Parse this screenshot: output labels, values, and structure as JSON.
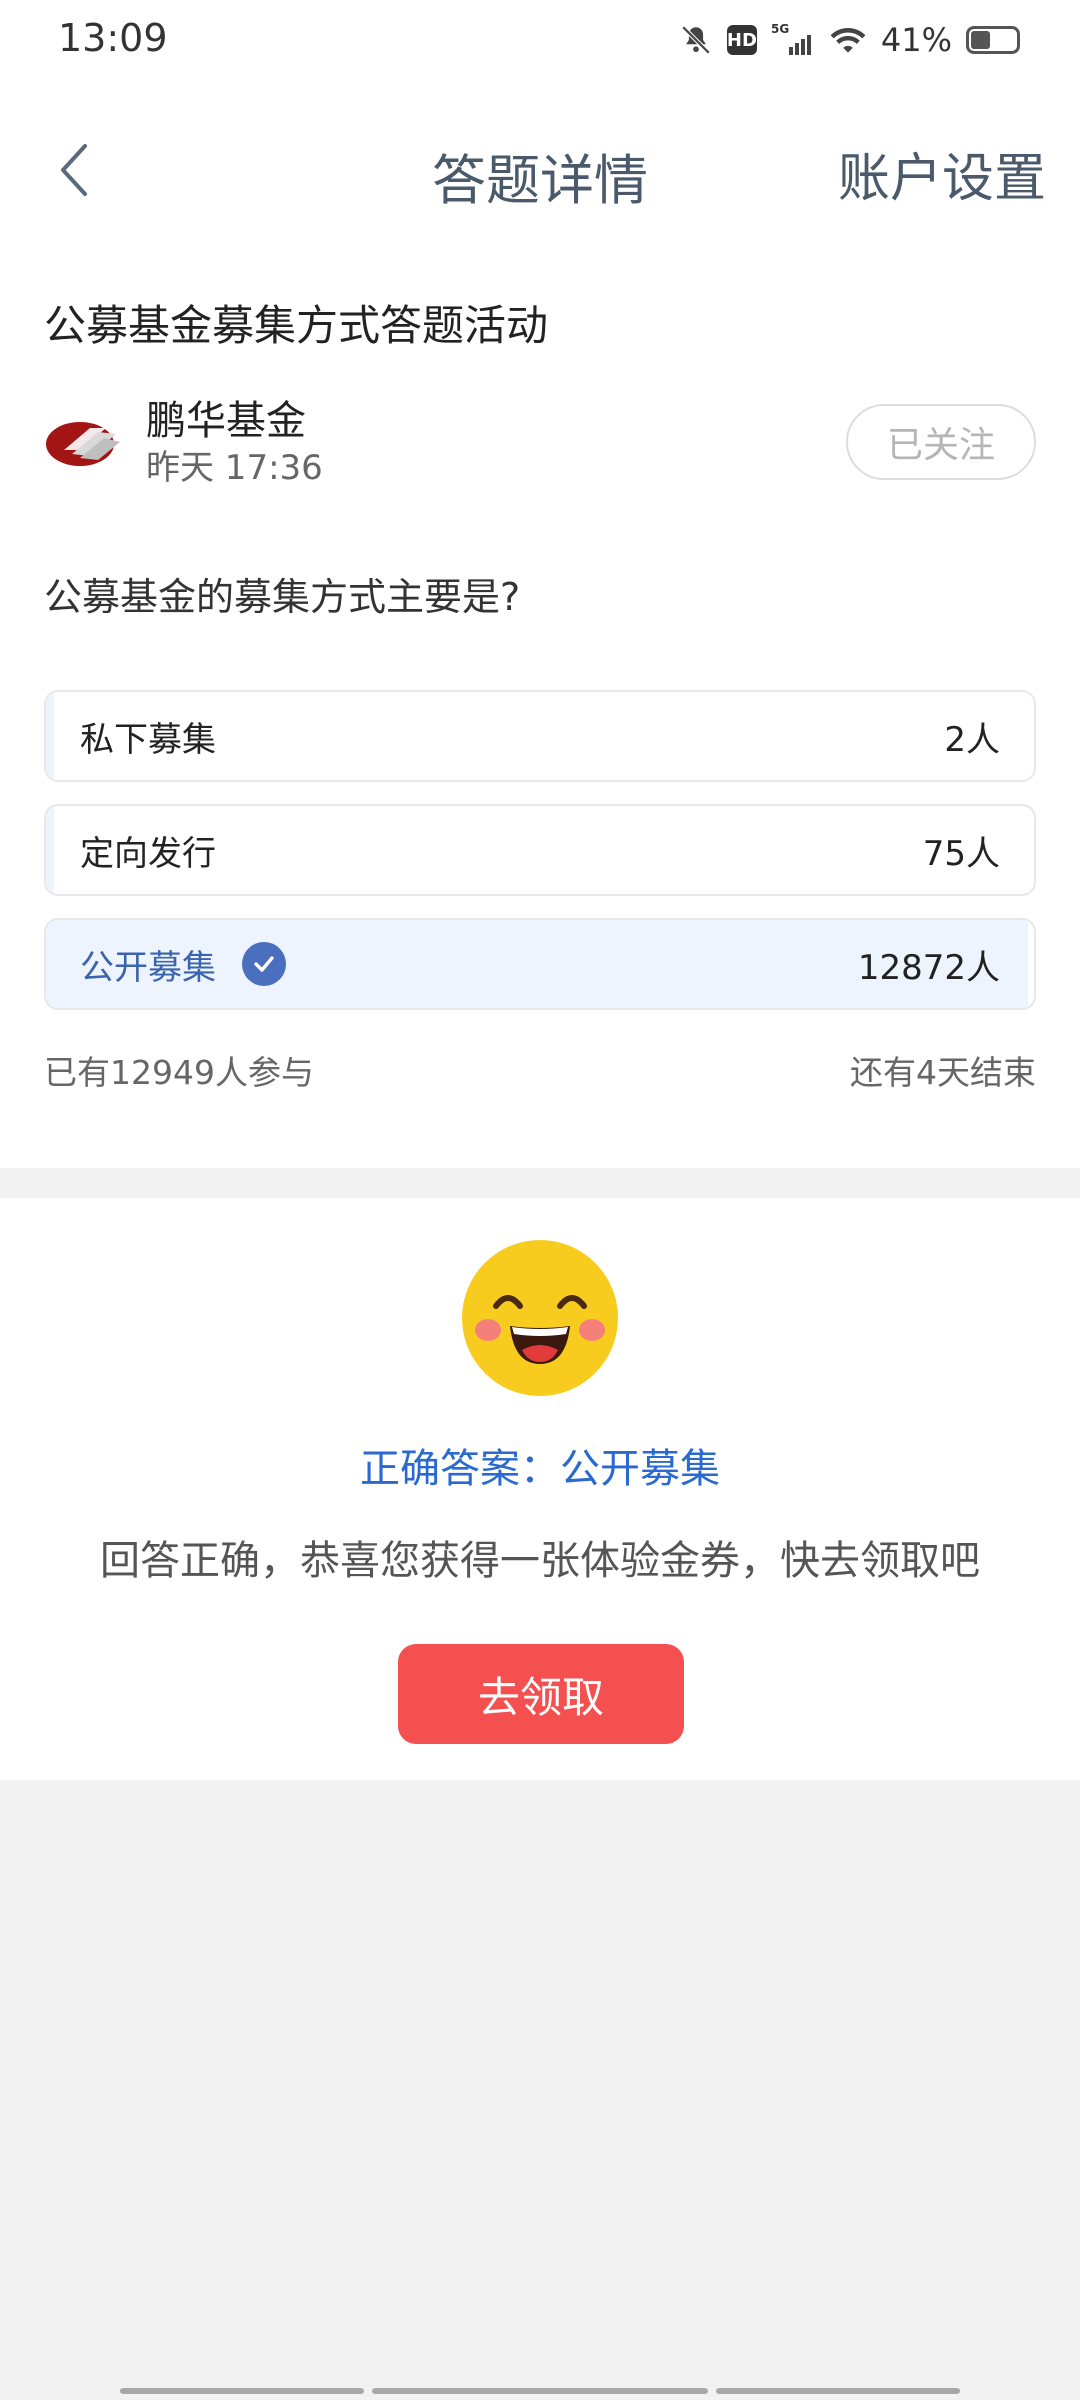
{
  "status_bar": {
    "time": "13:09",
    "network": "5G",
    "hd": "HD",
    "battery": "41%"
  },
  "header": {
    "title": "答题详情",
    "right_action": "账户设置"
  },
  "activity": {
    "title": "公募基金募集方式答题活动"
  },
  "author": {
    "name": "鹏华基金",
    "time": "昨天 17:36",
    "follow_label": "已关注"
  },
  "question": "公募基金的募集方式主要是?",
  "options": [
    {
      "label": "私下募集",
      "count": "2人",
      "fraction": 0.0002
    },
    {
      "label": "定向发行",
      "count": "75人",
      "fraction": 0.0058
    },
    {
      "label": "公开募集",
      "count": "12872人",
      "fraction": 0.994,
      "correct": true
    }
  ],
  "stats": {
    "participants": "已有12949人参与",
    "remaining": "还有4天结束"
  },
  "result": {
    "answer": "正确答案：公开募集",
    "message": "回答正确，恭喜您获得一张体验金券，快去领取吧",
    "button": "去领取"
  },
  "colors": {
    "accent": "#2a6ad0",
    "button": "#f45050",
    "correct_bar": "#eef4fd",
    "check": "#4a6fbe"
  }
}
